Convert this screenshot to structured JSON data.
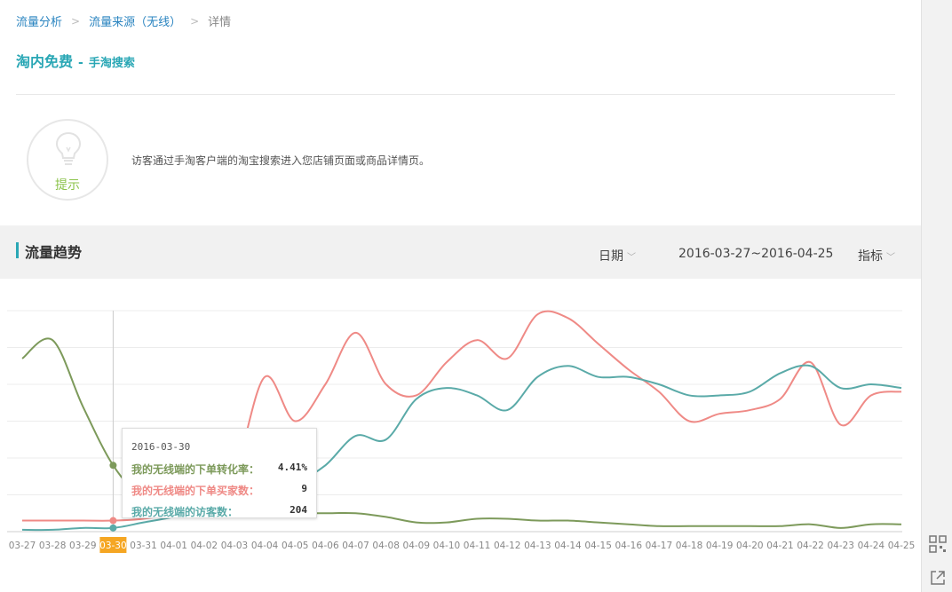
{
  "breadcrumb": [
    "流量分析",
    "流量来源（无线）",
    "详情"
  ],
  "title": {
    "main": "淘内免费",
    "sep": "-",
    "sub": "手淘搜索"
  },
  "tip": {
    "label": "提示",
    "text": "访客通过手淘客户端的淘宝搜索进入您店铺页面或商品详情页。"
  },
  "trend": {
    "title": "流量趋势",
    "date_label": "日期",
    "date_range": "2016-03-27~2016-04-25",
    "metric_label": "指标"
  },
  "tooltip": {
    "date": "2016-03-30",
    "rows": [
      {
        "label": "我的无线端的下单转化率：",
        "value": "4.41%"
      },
      {
        "label": "我的无线端的下单买家数：",
        "value": "9"
      },
      {
        "label": "我的无线端的访客数：",
        "value": "204"
      }
    ]
  },
  "colors": {
    "accent": "#2aa7b5",
    "conversion": "#7d9a5b",
    "buyers": "#ef8a86",
    "visitors": "#5aaaa8",
    "highlight": "#f5a623"
  },
  "chart_data": {
    "type": "line",
    "categories": [
      "03-27",
      "03-28",
      "03-29",
      "03-30",
      "03-31",
      "04-01",
      "04-02",
      "04-03",
      "04-04",
      "04-05",
      "04-06",
      "04-07",
      "04-08",
      "04-09",
      "04-10",
      "04-11",
      "04-12",
      "04-13",
      "04-14",
      "04-15",
      "04-16",
      "04-17",
      "04-18",
      "04-19",
      "04-20",
      "04-21",
      "04-22",
      "04-23",
      "04-24",
      "04-25"
    ],
    "highlight_category": "03-30",
    "ylim": [
      0,
      6
    ],
    "grid": true,
    "series": [
      {
        "name": "我的无线端的下单转化率",
        "color": "#7d9a5b",
        "values": [
          4.7,
          5.2,
          3.4,
          1.8,
          0.9,
          0.7,
          0.5,
          0.55,
          0.5,
          0.5,
          0.5,
          0.5,
          0.4,
          0.25,
          0.25,
          0.35,
          0.35,
          0.3,
          0.3,
          0.25,
          0.2,
          0.15,
          0.15,
          0.15,
          0.15,
          0.15,
          0.2,
          0.1,
          0.2,
          0.2
        ]
      },
      {
        "name": "我的无线端的下单买家数",
        "color": "#ef8a86",
        "values": [
          0.3,
          0.3,
          0.3,
          0.3,
          0.35,
          0.5,
          0.8,
          1.6,
          4.2,
          3.0,
          4.0,
          5.4,
          4.0,
          3.7,
          4.6,
          5.2,
          4.7,
          5.9,
          5.8,
          5.1,
          4.4,
          3.8,
          3.0,
          3.2,
          3.3,
          3.6,
          4.6,
          2.9,
          3.7,
          3.8
        ]
      },
      {
        "name": "我的无线端的访客数",
        "color": "#5aaaa8",
        "values": [
          0.05,
          0.05,
          0.1,
          0.1,
          0.25,
          0.4,
          0.6,
          0.8,
          1.0,
          1.3,
          1.8,
          2.6,
          2.5,
          3.6,
          3.9,
          3.7,
          3.3,
          4.2,
          4.5,
          4.2,
          4.2,
          4.0,
          3.7,
          3.7,
          3.8,
          4.3,
          4.5,
          3.9,
          4.0,
          3.9
        ]
      }
    ]
  }
}
